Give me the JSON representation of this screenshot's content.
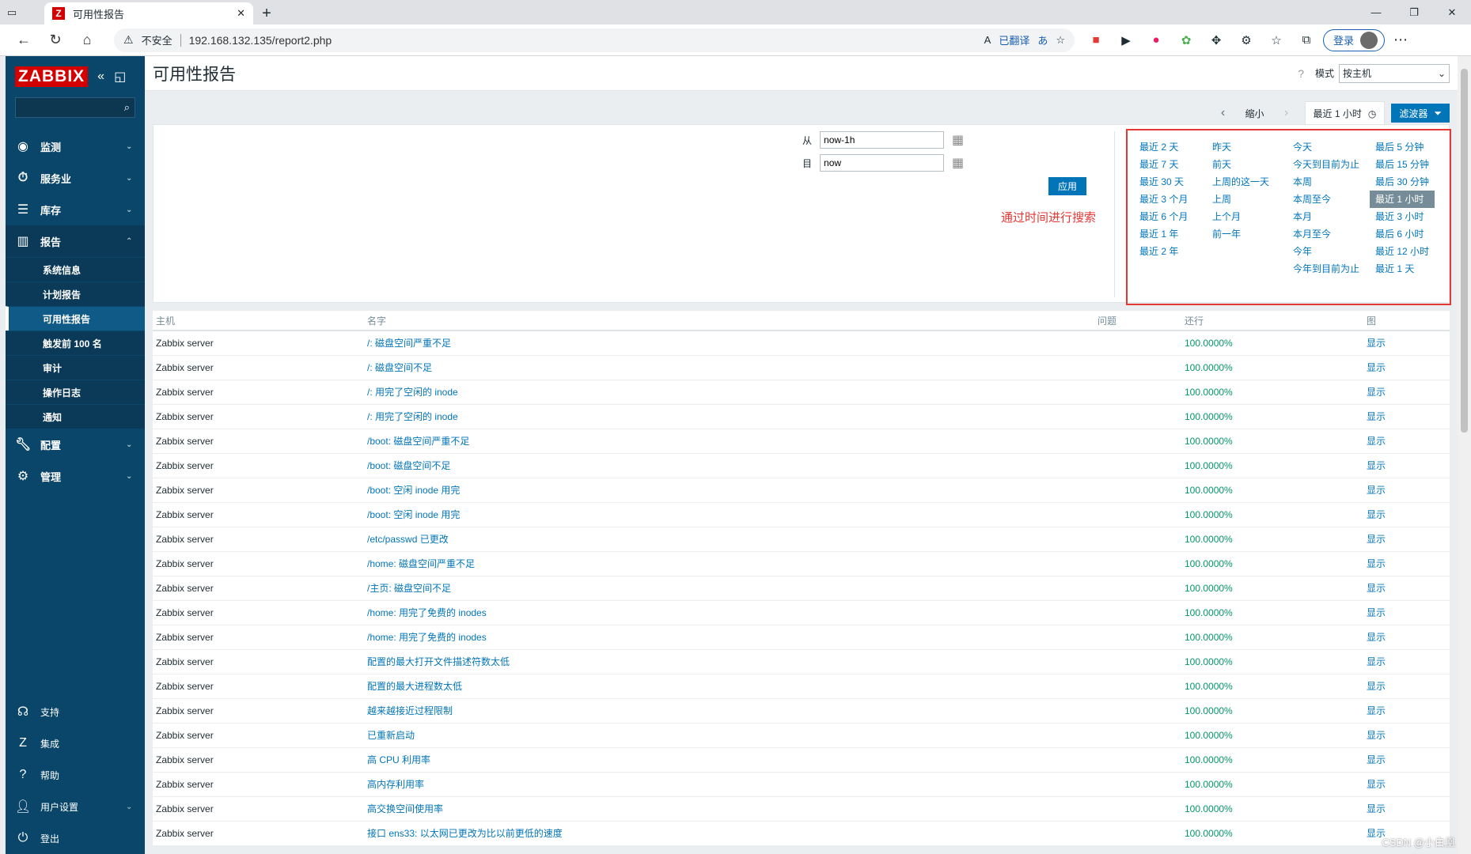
{
  "browser": {
    "tab_title": "可用性报告",
    "tab_icon": "Z",
    "insecure_label": "不安全",
    "url": "192.168.132.135/report2.php",
    "translated_label": "已翻译",
    "login_label": "登录"
  },
  "sidebar": {
    "logo": "ZABBIX",
    "items": [
      {
        "label": "监测",
        "icon": "eye-icon"
      },
      {
        "label": "服务业",
        "icon": "stopwatch-icon"
      },
      {
        "label": "库存",
        "icon": "list-icon"
      },
      {
        "label": "报告",
        "icon": "bar-chart-icon"
      },
      {
        "label": "配置",
        "icon": "wrench-icon"
      },
      {
        "label": "管理",
        "icon": "gear-icon"
      }
    ],
    "report_sub": [
      "系统信息",
      "计划报告",
      "可用性报告",
      "触发前 100 名",
      "审计",
      "操作日志",
      "通知"
    ],
    "bottom": [
      {
        "label": "支持",
        "icon": "headset-icon"
      },
      {
        "label": "集成",
        "icon": "z-icon"
      },
      {
        "label": "帮助",
        "icon": "question-icon"
      },
      {
        "label": "用户设置",
        "icon": "user-icon"
      },
      {
        "label": "登出",
        "icon": "power-icon"
      }
    ]
  },
  "header": {
    "title": "可用性报告",
    "mode_label": "模式",
    "mode_value": "按主机"
  },
  "timebar": {
    "zoom_label": "缩小",
    "current": "最近 1 小时",
    "filter_label": "滤波器"
  },
  "filter": {
    "from_label": "从",
    "from_value": "now-1h",
    "to_label": "目",
    "to_value": "now",
    "apply_label": "应用",
    "annotation": "通过时间进行搜索"
  },
  "quick": {
    "col1": [
      "最近 2 天",
      "最近 7 天",
      "最近 30 天",
      "最近 3 个月",
      "最近 6 个月",
      "最近 1 年",
      "最近 2 年"
    ],
    "col2": [
      "昨天",
      "前天",
      "上周的这一天",
      "上周",
      "上个月",
      "前一年"
    ],
    "col3": [
      "今天",
      "今天到目前为止",
      "本周",
      "本周至今",
      "本月",
      "本月至今",
      "今年",
      "今年到目前为止"
    ],
    "col4": [
      "最后 5 分钟",
      "最后 15 分钟",
      "最后 30 分钟",
      "最近 1 小时",
      "最近 3 小时",
      "最后 6 小时",
      "最近 12 小时",
      "最近 1 天"
    ]
  },
  "table": {
    "headers": [
      "主机",
      "名字",
      "问题",
      "还行",
      "图"
    ],
    "rows": [
      {
        "host": "Zabbix server",
        "name": "/:  磁盘空间严重不足",
        "problem": "",
        "ok": "100.0000%",
        "graph": "显示"
      },
      {
        "host": "Zabbix server",
        "name": "/:  磁盘空间不足",
        "problem": "",
        "ok": "100.0000%",
        "graph": "显示"
      },
      {
        "host": "Zabbix server",
        "name": "/:  用完了空闲的 inode",
        "problem": "",
        "ok": "100.0000%",
        "graph": "显示"
      },
      {
        "host": "Zabbix server",
        "name": "/:  用完了空闲的 inode",
        "problem": "",
        "ok": "100.0000%",
        "graph": "显示"
      },
      {
        "host": "Zabbix server",
        "name": "/boot: 磁盘空间严重不足",
        "problem": "",
        "ok": "100.0000%",
        "graph": "显示"
      },
      {
        "host": "Zabbix server",
        "name": "/boot: 磁盘空间不足",
        "problem": "",
        "ok": "100.0000%",
        "graph": "显示"
      },
      {
        "host": "Zabbix server",
        "name": "/boot: 空闲 inode 用完",
        "problem": "",
        "ok": "100.0000%",
        "graph": "显示"
      },
      {
        "host": "Zabbix server",
        "name": "/boot: 空闲 inode 用完",
        "problem": "",
        "ok": "100.0000%",
        "graph": "显示"
      },
      {
        "host": "Zabbix server",
        "name": "/etc/passwd 已更改",
        "problem": "",
        "ok": "100.0000%",
        "graph": "显示"
      },
      {
        "host": "Zabbix server",
        "name": "/home: 磁盘空间严重不足",
        "problem": "",
        "ok": "100.0000%",
        "graph": "显示"
      },
      {
        "host": "Zabbix server",
        "name": "/主页: 磁盘空间不足",
        "problem": "",
        "ok": "100.0000%",
        "graph": "显示"
      },
      {
        "host": "Zabbix server",
        "name": "/home:  用完了免费的 inodes",
        "problem": "",
        "ok": "100.0000%",
        "graph": "显示"
      },
      {
        "host": "Zabbix server",
        "name": "/home:  用完了免费的 inodes",
        "problem": "",
        "ok": "100.0000%",
        "graph": "显示"
      },
      {
        "host": "Zabbix server",
        "name": "配置的最大打开文件描述符数太低",
        "problem": "",
        "ok": "100.0000%",
        "graph": "显示"
      },
      {
        "host": "Zabbix server",
        "name": "配置的最大进程数太低",
        "problem": "",
        "ok": "100.0000%",
        "graph": "显示"
      },
      {
        "host": "Zabbix server",
        "name": "越来越接近过程限制",
        "problem": "",
        "ok": "100.0000%",
        "graph": "显示"
      },
      {
        "host": "Zabbix server",
        "name": "已重新启动",
        "problem": "",
        "ok": "100.0000%",
        "graph": "显示"
      },
      {
        "host": "Zabbix server",
        "name": "高 CPU 利用率",
        "problem": "",
        "ok": "100.0000%",
        "graph": "显示"
      },
      {
        "host": "Zabbix server",
        "name": "高内存利用率",
        "problem": "",
        "ok": "100.0000%",
        "graph": "显示"
      },
      {
        "host": "Zabbix server",
        "name": "高交换空间使用率",
        "problem": "",
        "ok": "100.0000%",
        "graph": "显示"
      },
      {
        "host": "Zabbix server",
        "name": "接口 ens33: 以太网已更改为比以前更低的速度",
        "problem": "",
        "ok": "100.0000%",
        "graph": "显示"
      }
    ]
  },
  "watermark": "CSDN @小白凰"
}
